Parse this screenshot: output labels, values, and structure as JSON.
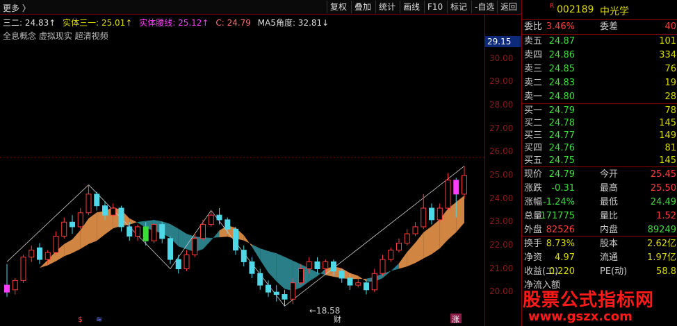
{
  "toolbar": {
    "more": "更多 〉",
    "buttons": [
      "复权",
      "叠加",
      "统计",
      "画线",
      "F10",
      "标记",
      "-自选",
      "返回"
    ]
  },
  "indicator": {
    "a_label": "三二: 24.83↑",
    "b_label": "实体三一: 25.01↑",
    "c_label": "实体腰线: 25.12↑",
    "d_label": "C: 24.79",
    "e_label": "MA5角度: 32.81↓"
  },
  "concepts": "全息概念 虚拟现实 超清视频",
  "axis": {
    "ticks": [
      "30.00",
      "29.00",
      "28.00",
      "27.00",
      "26.00",
      "25.00",
      "24.00",
      "23.00",
      "22.00",
      "21.00",
      "20.00"
    ],
    "current_price": "29.15"
  },
  "chart_data": {
    "type": "candlestick",
    "ylim": [
      19.5,
      30.2
    ],
    "low_annotation": "←18.58",
    "markers": [
      "$",
      "≋",
      "财",
      "涨"
    ],
    "candles": [
      [
        20.3,
        20.0,
        21.2,
        19.8
      ],
      [
        20.1,
        20.5,
        20.6,
        19.9
      ],
      [
        20.5,
        21.5,
        21.6,
        20.4
      ],
      [
        21.5,
        21.8,
        22.0,
        21.3
      ],
      [
        21.9,
        21.4,
        22.1,
        21.2
      ],
      [
        21.4,
        21.7,
        21.8,
        21.2
      ],
      [
        21.7,
        22.4,
        22.6,
        21.6
      ],
      [
        22.4,
        23.0,
        23.2,
        22.3
      ],
      [
        23.0,
        22.8,
        23.3,
        22.5
      ],
      [
        22.8,
        23.4,
        23.6,
        22.7
      ],
      [
        23.4,
        24.2,
        24.6,
        23.3
      ],
      [
        24.2,
        23.7,
        24.3,
        23.5
      ],
      [
        23.7,
        23.3,
        23.9,
        23.1
      ],
      [
        23.3,
        23.6,
        23.8,
        23.2
      ],
      [
        23.6,
        22.8,
        23.7,
        22.6
      ],
      [
        22.8,
        22.4,
        23.0,
        22.2
      ],
      [
        22.4,
        22.8,
        22.9,
        22.2
      ],
      [
        22.8,
        22.2,
        23.0,
        22.0
      ],
      [
        22.2,
        22.9,
        23.1,
        22.1
      ],
      [
        22.9,
        22.3,
        23.0,
        22.1
      ],
      [
        22.3,
        21.4,
        22.4,
        21.2
      ],
      [
        21.4,
        21.0,
        21.6,
        20.8
      ],
      [
        21.0,
        21.6,
        21.8,
        20.9
      ],
      [
        21.6,
        22.3,
        22.5,
        21.5
      ],
      [
        22.3,
        22.9,
        23.1,
        22.2
      ],
      [
        22.9,
        23.3,
        23.5,
        22.8
      ],
      [
        23.3,
        23.1,
        23.6,
        22.9
      ],
      [
        23.1,
        22.7,
        23.2,
        22.5
      ],
      [
        22.7,
        21.8,
        22.8,
        21.6
      ],
      [
        21.8,
        21.3,
        22.0,
        21.1
      ],
      [
        21.3,
        20.8,
        21.5,
        20.6
      ],
      [
        20.8,
        20.3,
        21.0,
        20.1
      ],
      [
        20.3,
        20.0,
        20.5,
        19.8
      ],
      [
        20.0,
        19.9,
        20.3,
        19.6
      ],
      [
        19.9,
        19.7,
        20.1,
        19.4
      ],
      [
        19.7,
        20.4,
        20.6,
        19.5
      ],
      [
        20.4,
        21.0,
        21.2,
        20.3
      ],
      [
        21.0,
        21.3,
        21.5,
        20.8
      ],
      [
        21.3,
        21.0,
        21.5,
        20.8
      ],
      [
        21.0,
        21.3,
        21.4,
        20.8
      ],
      [
        21.3,
        20.9,
        21.4,
        20.7
      ],
      [
        20.9,
        20.6,
        21.0,
        20.4
      ],
      [
        20.6,
        20.3,
        20.8,
        20.1
      ],
      [
        20.3,
        20.4,
        20.6,
        20.2
      ],
      [
        20.4,
        20.1,
        20.5,
        19.9
      ],
      [
        20.1,
        20.8,
        21.0,
        20.0
      ],
      [
        20.8,
        21.4,
        21.6,
        20.7
      ],
      [
        21.4,
        21.8,
        21.9,
        21.3
      ],
      [
        21.8,
        22.1,
        22.3,
        21.7
      ],
      [
        22.1,
        22.5,
        22.7,
        22.0
      ],
      [
        22.5,
        22.8,
        23.0,
        22.4
      ],
      [
        22.8,
        23.6,
        24.2,
        22.7
      ],
      [
        23.6,
        23.1,
        23.8,
        22.9
      ],
      [
        23.1,
        23.6,
        23.8,
        23.0
      ],
      [
        23.6,
        24.8,
        25.1,
        23.5
      ],
      [
        24.8,
        24.2,
        24.9,
        23.2
      ],
      [
        24.2,
        25.0,
        25.4,
        24.0
      ]
    ]
  },
  "panel": {
    "code": "002189",
    "name": "中光学",
    "badge": "R",
    "weibi_label": "委比",
    "weibi": "3.46%",
    "weicha_label": "委差",
    "weicha": "40",
    "sell": [
      {
        "label": "卖五",
        "price": "24.87",
        "vol": "101"
      },
      {
        "label": "卖四",
        "price": "24.86",
        "vol": "334"
      },
      {
        "label": "卖三",
        "price": "24.85",
        "vol": "76"
      },
      {
        "label": "卖二",
        "price": "24.83",
        "vol": "19"
      },
      {
        "label": "卖一",
        "price": "24.80",
        "vol": "28"
      }
    ],
    "buy": [
      {
        "label": "买一",
        "price": "24.79",
        "vol": "78"
      },
      {
        "label": "买二",
        "price": "24.78",
        "vol": "145"
      },
      {
        "label": "买三",
        "price": "24.77",
        "vol": "149"
      },
      {
        "label": "买四",
        "price": "24.76",
        "vol": "81"
      },
      {
        "label": "买五",
        "price": "24.75",
        "vol": "145"
      }
    ],
    "stats1": [
      {
        "l": "现价",
        "v": "24.79",
        "m": "今开",
        "mv": "25.45"
      },
      {
        "l": "涨跌",
        "v": "-0.31",
        "m": "最高",
        "mv": "25.50"
      },
      {
        "l": "涨幅",
        "v": "-1.24%",
        "m": "最低",
        "mv": "24.49"
      },
      {
        "l": "总量",
        "v": "171775",
        "m": "量比",
        "mv": "1.52"
      },
      {
        "l": "外盘",
        "v": "82526",
        "m": "内盘",
        "mv": "89249"
      }
    ],
    "stats2": [
      {
        "l": "换手",
        "v": "8.73%",
        "m": "股本",
        "mv": "2.62亿"
      },
      {
        "l": "净资",
        "v": "4.97",
        "m": "流通",
        "mv": "1.97亿"
      },
      {
        "l": "收益(二)",
        "v": "0.220",
        "m": "PE(动)",
        "mv": "58.8"
      }
    ],
    "partial_row": "净流入额",
    "watermark": "股票公式指标网",
    "watermark_url": "www.gszx.com"
  }
}
